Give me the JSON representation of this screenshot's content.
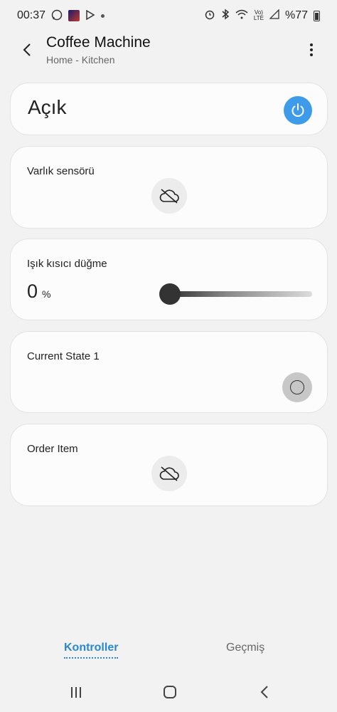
{
  "status_bar": {
    "time": "00:37",
    "battery": "%77",
    "icons": [
      "whatsapp-icon",
      "app-thumbnail-icon",
      "play-store-icon",
      "notification-dot-icon",
      "alarm-icon",
      "bluetooth-icon",
      "wifi-icon",
      "volte-icon",
      "signal-icon",
      "battery-icon"
    ]
  },
  "header": {
    "title": "Coffee Machine",
    "subtitle": "Home - Kitchen"
  },
  "power_card": {
    "label": "Açık",
    "accent_color": "#3e9be9"
  },
  "sensor_card": {
    "label": "Varlık sensörü"
  },
  "dimmer_card": {
    "label": "Işık kısıcı düğme",
    "value": "0",
    "unit": "%",
    "level": 0
  },
  "state_card": {
    "label": "Current State 1"
  },
  "order_card": {
    "label": "Order Item"
  },
  "tabs": {
    "active": "Kontroller",
    "items": [
      "Kontroller",
      "Geçmiş"
    ],
    "active_color": "#2b87d1"
  }
}
